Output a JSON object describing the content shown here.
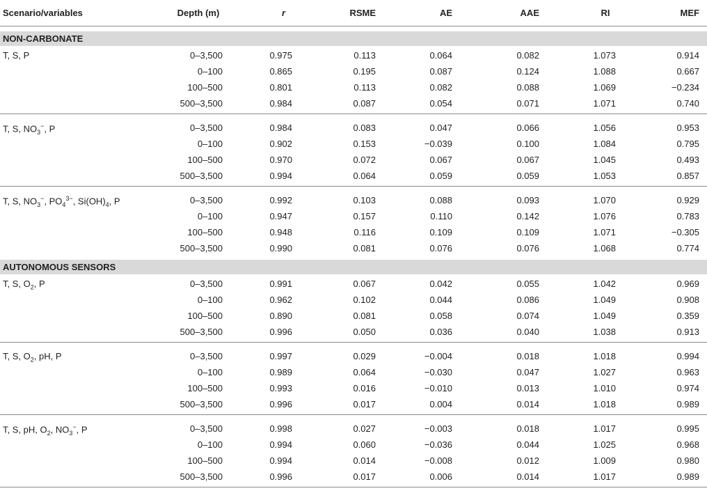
{
  "headers": {
    "scenario": "Scenario/variables",
    "depth": "Depth (m)",
    "r": "r",
    "rsme": "RSME",
    "ae": "AE",
    "aae": "AAE",
    "ri": "RI",
    "mef": "MEF"
  },
  "sections": [
    {
      "title": "NON-CARBONATE",
      "groups": [
        {
          "label_parts": [
            "T, S, P"
          ],
          "rows": [
            [
              "0–3,500",
              "0.975",
              "0.113",
              "0.064",
              "0.082",
              "1.073",
              "0.914"
            ],
            [
              "0–100",
              "0.865",
              "0.195",
              "0.087",
              "0.124",
              "1.088",
              "0.667"
            ],
            [
              "100–500",
              "0.801",
              "0.113",
              "0.082",
              "0.088",
              "1.069",
              "−0.234"
            ],
            [
              "500–3,500",
              "0.984",
              "0.087",
              "0.054",
              "0.071",
              "1.071",
              "0.740"
            ]
          ]
        },
        {
          "label_parts": [
            "T, S, NO",
            "3",
            "−",
            ", P"
          ],
          "rows": [
            [
              "0–3,500",
              "0.984",
              "0.083",
              "0.047",
              "0.066",
              "1.056",
              "0.953"
            ],
            [
              "0–100",
              "0.902",
              "0.153",
              "−0.039",
              "0.100",
              "1.084",
              "0.795"
            ],
            [
              "100–500",
              "0.970",
              "0.072",
              "0.067",
              "0.067",
              "1.045",
              "0.493"
            ],
            [
              "500–3,500",
              "0.994",
              "0.064",
              "0.059",
              "0.059",
              "1.053",
              "0.857"
            ]
          ]
        },
        {
          "label_parts": [
            "T, S, NO",
            "3",
            "−",
            ", PO",
            "4",
            "3−",
            ", Si(OH)",
            "4",
            ", P"
          ],
          "rows": [
            [
              "0–3,500",
              "0.992",
              "0.103",
              "0.088",
              "0.093",
              "1.070",
              "0.929"
            ],
            [
              "0–100",
              "0.947",
              "0.157",
              "0.110",
              "0.142",
              "1.076",
              "0.783"
            ],
            [
              "100–500",
              "0.948",
              "0.116",
              "0.109",
              "0.109",
              "1.071",
              "−0.305"
            ],
            [
              "500–3,500",
              "0.990",
              "0.081",
              "0.076",
              "0.076",
              "1.068",
              "0.774"
            ]
          ]
        }
      ]
    },
    {
      "title": "AUTONOMOUS SENSORS",
      "groups": [
        {
          "label_parts": [
            "T, S, O",
            "2",
            ", P"
          ],
          "rows": [
            [
              "0–3,500",
              "0.991",
              "0.067",
              "0.042",
              "0.055",
              "1.042",
              "0.969"
            ],
            [
              "0–100",
              "0.962",
              "0.102",
              "0.044",
              "0.086",
              "1.049",
              "0.908"
            ],
            [
              "100–500",
              "0.890",
              "0.081",
              "0.058",
              "0.074",
              "1.049",
              "0.359"
            ],
            [
              "500–3,500",
              "0.996",
              "0.050",
              "0.036",
              "0.040",
              "1.038",
              "0.913"
            ]
          ]
        },
        {
          "label_parts": [
            "T, S, O",
            "2",
            ", pH, P"
          ],
          "rows": [
            [
              "0–3,500",
              "0.997",
              "0.029",
              "−0.004",
              "0.018",
              "1.018",
              "0.994"
            ],
            [
              "0–100",
              "0.989",
              "0.064",
              "−0.030",
              "0.047",
              "1.027",
              "0.963"
            ],
            [
              "100–500",
              "0.993",
              "0.016",
              "−0.010",
              "0.013",
              "1.010",
              "0.974"
            ],
            [
              "500–3,500",
              "0.996",
              "0.017",
              "0.004",
              "0.014",
              "1.018",
              "0.989"
            ]
          ]
        },
        {
          "label_parts": [
            "T, S, pH, O",
            "2",
            ", NO",
            "3",
            "−",
            ", P"
          ],
          "rows": [
            [
              "0–3,500",
              "0.998",
              "0.027",
              "−0.003",
              "0.018",
              "1.017",
              "0.995"
            ],
            [
              "0–100",
              "0.994",
              "0.060",
              "−0.036",
              "0.044",
              "1.025",
              "0.968"
            ],
            [
              "100–500",
              "0.994",
              "0.014",
              "−0.008",
              "0.012",
              "1.009",
              "0.980"
            ],
            [
              "500–3,500",
              "0.996",
              "0.017",
              "0.006",
              "0.014",
              "1.017",
              "0.989"
            ]
          ]
        }
      ]
    }
  ]
}
